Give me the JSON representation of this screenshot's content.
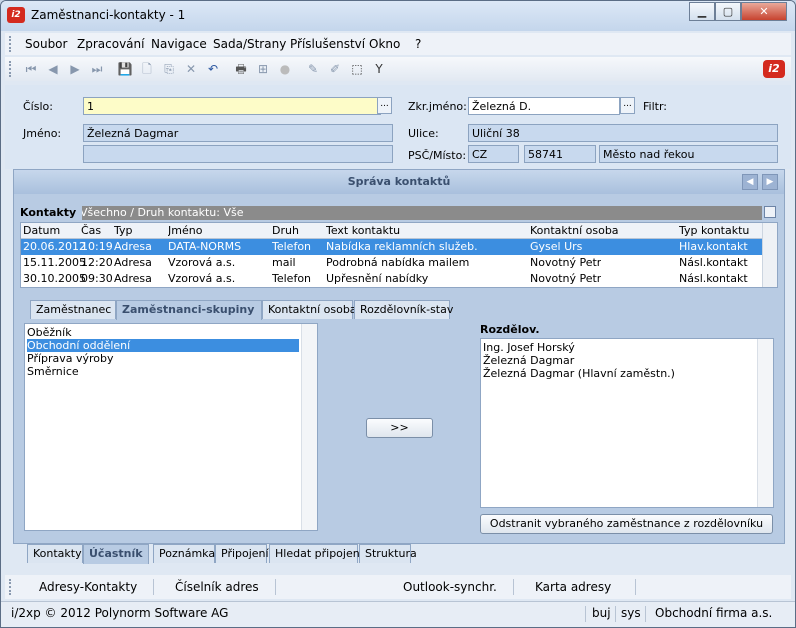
{
  "window": {
    "title": "Zaměstnanci-kontakty - 1",
    "app_icon": "i2",
    "minimize": "▁",
    "maximize": "▢",
    "close": "✕"
  },
  "menu": [
    "Soubor",
    "Zpracování",
    "Navigace",
    "Sada/Strany",
    "Příslušenství",
    "Okno",
    "?"
  ],
  "toolbar": {
    "icons": [
      "first-icon",
      "prev-icon",
      "next-icon",
      "last-icon",
      "save-icon",
      "new-icon",
      "copy-icon",
      "delete-icon",
      "undo-icon",
      "print-icon",
      "tree-icon",
      "stop-icon",
      "edit-icon",
      "pen-icon",
      "export-icon",
      "filter-icon"
    ],
    "glyphs": [
      "⏮",
      "◀",
      "▶",
      "⏭",
      "💾",
      "🗋",
      "⎘",
      "✕",
      "↶",
      "🖶",
      "⊞",
      "●",
      "✎",
      "✐",
      "⬚",
      "Y"
    ],
    "logo": "i2"
  },
  "form": {
    "cislo_label": "Číslo:",
    "cislo_value": "1",
    "jmeno_label": "Jméno:",
    "jmeno_value": "Železná Dagmar",
    "jmeno2_value": "",
    "zkr_label": "Zkr.jméno:",
    "zkr_value": "Železná D.",
    "filtr_label": "Filtr:",
    "ulice_label": "Ulice:",
    "ulice_value": "Uliční 38",
    "psc_label": "PSČ/Místo:",
    "country": "CZ",
    "psc": "58741",
    "misto": "Město nad řekou",
    "ellipsis": "..."
  },
  "panel": {
    "title": "Správa kontaktů",
    "prev": "◀",
    "next": "▶"
  },
  "kontakty": {
    "label": "Kontakty",
    "filter": "Všechno / Druh kontaktu: Vše",
    "columns": [
      "Datum",
      "Čas",
      "Typ",
      "Jméno",
      "Druh",
      "Text kontaktu",
      "Kontaktní osoba",
      "Typ kontaktu"
    ],
    "rows": [
      [
        "20.06.2012",
        "10:19",
        "Adresa",
        "DATA-NORMS",
        "Telefon",
        "Nabídka reklamních služeb.",
        "Gysel Urs",
        "Hlav.kontakt"
      ],
      [
        "15.11.2005",
        "12:20",
        "Adresa",
        "Vzorová a.s.",
        "mail",
        "Podrobná nabídka mailem",
        "Novotný Petr",
        "Násl.kontakt"
      ],
      [
        "30.10.2005",
        "09:30",
        "Adresa",
        "Vzorová a.s.",
        "Telefon",
        "Upřesnění nabídky",
        "Novotný Petr",
        "Násl.kontakt"
      ]
    ]
  },
  "inner_tabs": [
    "Zaměstnanec",
    "Zaměstnanci-skupiny",
    "Kontaktní osoba",
    "Rozdělovník-stav"
  ],
  "groups": {
    "items": [
      "Oběžník",
      "Obchodní oddělení",
      "Příprava výroby",
      "Směrnice"
    ],
    "selected": 1
  },
  "move_button": ">>",
  "rozdelov": {
    "label": "Rozdělov.",
    "items": [
      "Ing. Josef Horský",
      "Železná Dagmar",
      "Železná Dagmar (Hlavní zaměstn.)"
    ],
    "remove_button": "Odstranit vybraného zaměstnance z rozdělovníku"
  },
  "bottom_tabs": [
    "Kontakty",
    "Účastník",
    "Poznámka",
    "Připojení",
    "Hledat připojení",
    "Struktura"
  ],
  "bottom_bar": [
    "Adresy-Kontakty",
    "Číselník adres",
    "Outlook-synchr.",
    "Karta adresy"
  ],
  "status": {
    "copyright": "i/2xp © 2012 Polynorm Software AG",
    "user": "buj",
    "sys": "sys",
    "company": "Obchodní firma a.s."
  }
}
